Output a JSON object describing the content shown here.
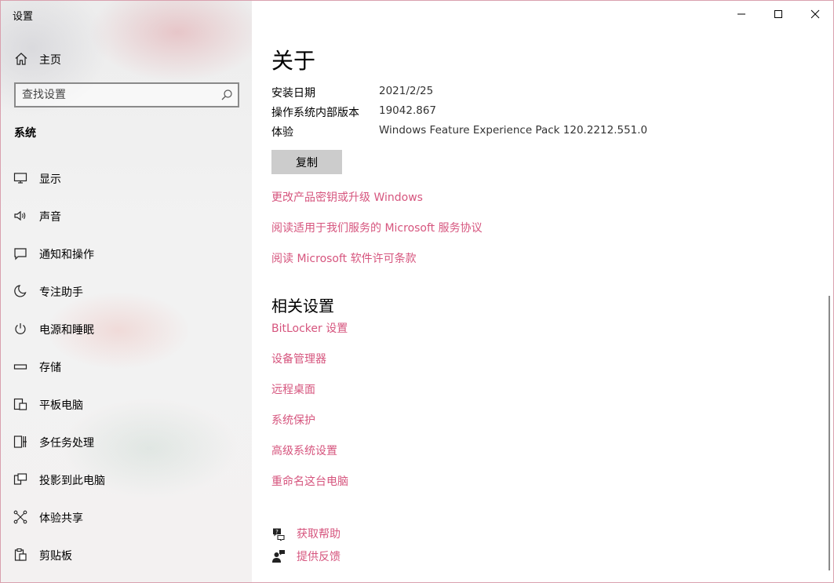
{
  "window": {
    "title": "设置",
    "accent": "#d6557e"
  },
  "sidebar": {
    "home_label": "主页",
    "search_placeholder": "查找设置",
    "section_label": "系统",
    "items": [
      {
        "label": "显示",
        "icon": "monitor-icon"
      },
      {
        "label": "声音",
        "icon": "speaker-icon"
      },
      {
        "label": "通知和操作",
        "icon": "notification-icon"
      },
      {
        "label": "专注助手",
        "icon": "moon-icon"
      },
      {
        "label": "电源和睡眠",
        "icon": "power-icon"
      },
      {
        "label": "存储",
        "icon": "storage-icon"
      },
      {
        "label": "平板电脑",
        "icon": "tablet-icon"
      },
      {
        "label": "多任务处理",
        "icon": "multitasking-icon"
      },
      {
        "label": "投影到此电脑",
        "icon": "project-icon"
      },
      {
        "label": "体验共享",
        "icon": "shared-experience-icon"
      },
      {
        "label": "剪贴板",
        "icon": "clipboard-icon"
      }
    ]
  },
  "main": {
    "title": "关于",
    "specs": [
      {
        "key": "安装日期",
        "value": "2021/2/25"
      },
      {
        "key": "操作系统内部版本",
        "value": "19042.867"
      },
      {
        "key": "体验",
        "value": "Windows Feature Experience Pack 120.2212.551.0"
      }
    ],
    "copy_label": "复制",
    "links": [
      "更改产品密钥或升级 Windows",
      "阅读适用于我们服务的 Microsoft 服务协议",
      "阅读 Microsoft 软件许可条款"
    ],
    "related_title": "相关设置",
    "related_links": [
      "BitLocker 设置",
      "设备管理器",
      "远程桌面",
      "系统保护",
      "高级系统设置",
      "重命名这台电脑"
    ],
    "help": [
      {
        "label": "获取帮助",
        "icon": "help-chat-icon"
      },
      {
        "label": "提供反馈",
        "icon": "feedback-icon"
      }
    ]
  }
}
